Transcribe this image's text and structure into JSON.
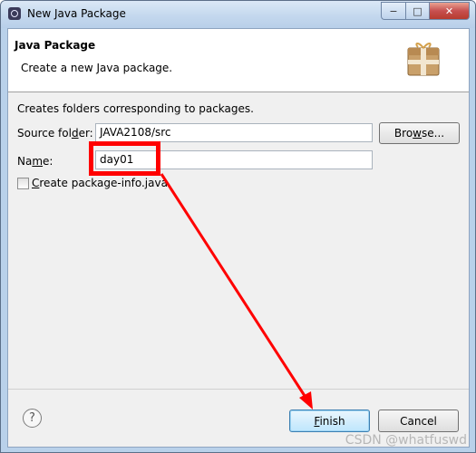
{
  "window": {
    "title": "New Java Package",
    "caption_buttons": {
      "minimize": "−",
      "maximize": "□",
      "close": "✕"
    }
  },
  "banner": {
    "title": "Java Package",
    "description": "Create a new Java package.",
    "icon": "package-icon"
  },
  "form": {
    "info": "Creates folders corresponding to packages.",
    "source_folder": {
      "label": "Source folder:",
      "value": "JAVA2108/src",
      "browse_label": "Browse..."
    },
    "name": {
      "label": "Name:",
      "value": "day01"
    },
    "create_package_info": {
      "label": "Create package-info.java",
      "checked": false
    }
  },
  "footer": {
    "help_symbol": "?",
    "finish_label": "Finish",
    "cancel_label": "Cancel"
  },
  "annotation": {
    "color": "#ff0000"
  },
  "watermark": "CSDN @whatfuswd"
}
